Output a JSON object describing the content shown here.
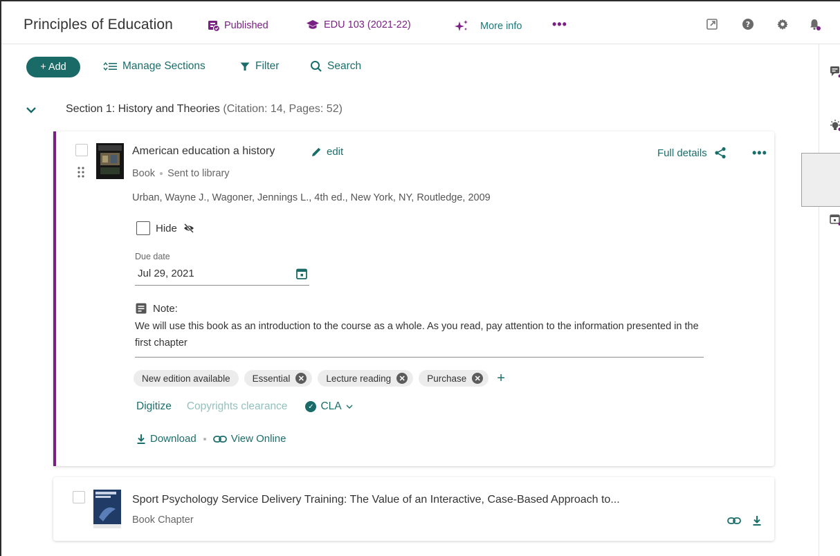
{
  "header": {
    "course_title": "Principles of Education",
    "status": "Published",
    "course_code": "EDU 103 (2021-22)",
    "more_info": "More info"
  },
  "toolbar": {
    "add_label": "+ Add",
    "manage_sections": "Manage Sections",
    "filter": "Filter",
    "search": "Search"
  },
  "section": {
    "title": "Section 1: History and Theories",
    "meta": "(Citation: 14, Pages: 52)"
  },
  "items": [
    {
      "title": "American education a history",
      "edit_label": "edit",
      "type": "Book",
      "status": "Sent to library",
      "citation": "Urban, Wayne J., Wagoner, Jennings L., 4th ed., New York, NY, Routledge, 2009",
      "full_details": "Full details",
      "hide_label": "Hide",
      "due_date_label": "Due date",
      "due_date": "Jul 29, 2021",
      "note_label": "Note:",
      "note_text": "We will use this book as an introduction to the course as a whole. As you read, pay attention to the information presented in the first chapter",
      "tags": [
        "New edition available",
        "Essential",
        "Lecture reading",
        "Purchase"
      ],
      "digitize": "Digitize",
      "copyright": "Copyrights clearance",
      "cla": "CLA",
      "download": "Download",
      "view_online": "View Online"
    },
    {
      "title": "Sport Psychology Service Delivery Training: The Value of an Interactive, Case-Based Approach to...",
      "type": "Book Chapter"
    }
  ],
  "colors": {
    "accent_teal": "#1a6b68",
    "accent_purple": "#7a2085"
  },
  "icons": {
    "header": [
      "published-icon",
      "graduation-cap-icon",
      "sparkle-icon",
      "more-horizontal-icon",
      "open-external-icon",
      "help-icon",
      "gear-icon",
      "bell-icon"
    ],
    "rail": [
      "comments-icon",
      "lightbulb-icon",
      "calendar-icon"
    ]
  }
}
